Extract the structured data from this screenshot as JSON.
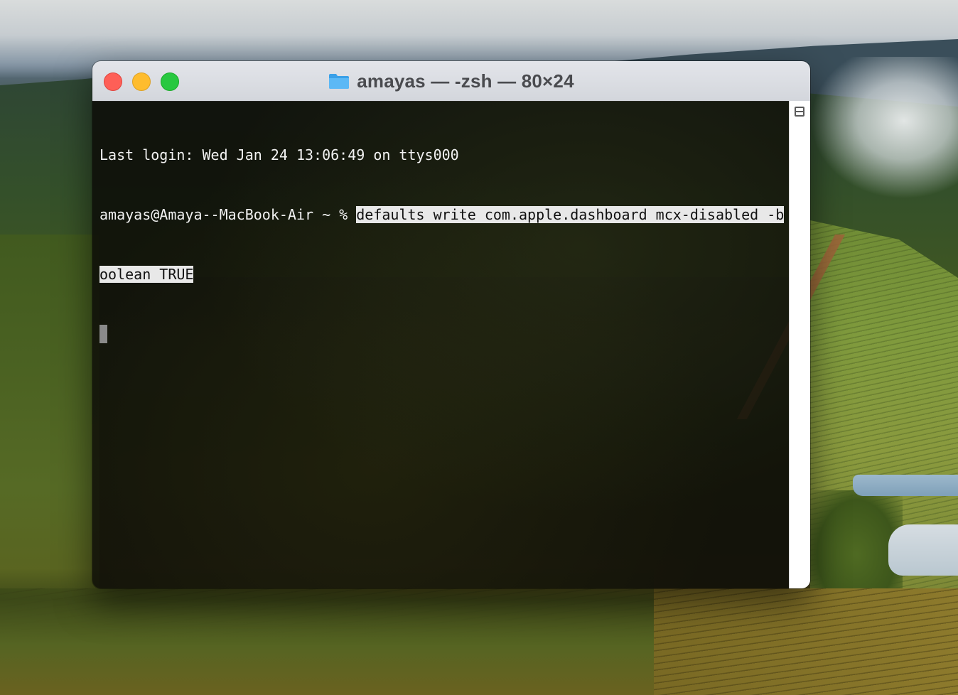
{
  "window": {
    "title": "amayas — -zsh — 80×24",
    "folder_icon": "folder-icon",
    "colors": {
      "close": "#fe5f57",
      "minimize": "#febc2e",
      "maximize": "#28c840"
    }
  },
  "terminal": {
    "last_login": "Last login: Wed Jan 24 13:06:49 on ttys000",
    "prompt": "amayas@Amaya--MacBook-Air ~ % ",
    "command_line1": "defaults write com.apple.dashboard mcx-disabled -b",
    "command_line2": "oolean TRUE"
  },
  "scrollbar": {
    "icon": "split-view-icon"
  }
}
